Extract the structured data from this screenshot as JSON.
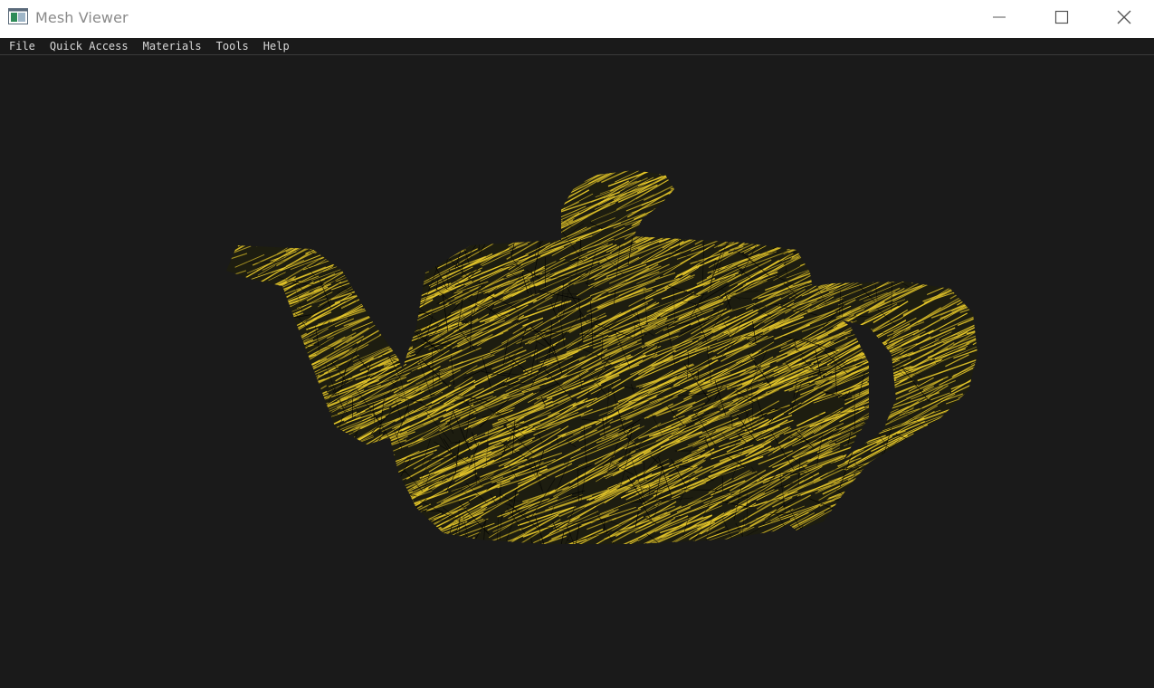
{
  "window": {
    "title": "Mesh Viewer",
    "app_icon": "window-app-icon",
    "controls": {
      "minimize_icon": "minimize-icon",
      "maximize_icon": "maximize-icon",
      "close_icon": "close-icon"
    }
  },
  "menubar": {
    "items": [
      {
        "label": "File"
      },
      {
        "label": "Quick Access"
      },
      {
        "label": "Materials"
      },
      {
        "label": "Tools"
      },
      {
        "label": "Help"
      }
    ]
  },
  "viewport": {
    "background_color": "#1a1a1a",
    "mesh_color": "#e8c92a",
    "wire_color": "#000000",
    "render_mode": "wireframe-over-solid"
  }
}
